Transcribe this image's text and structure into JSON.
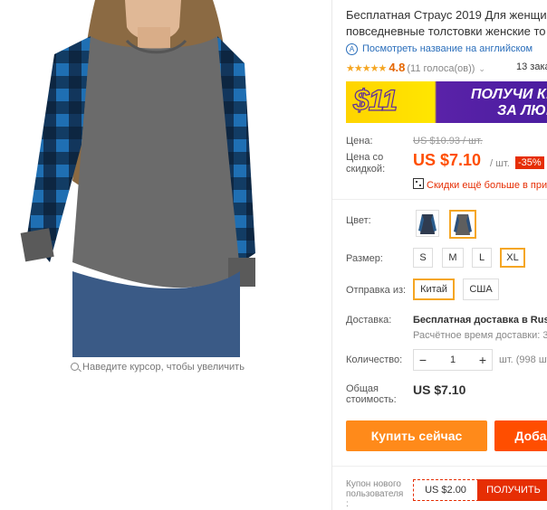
{
  "gallery": {
    "zoom_hint": "Наведите курсор, чтобы увеличить"
  },
  "product": {
    "title_line1": "Бесплатная Страус 2019 Для женщи",
    "title_line2": "повседневные толстовки женские то",
    "translate_link": "Посмотреть название на английском",
    "rating_value": "4.8",
    "votes": "(11 голоса(ов))",
    "orders": "13 зака"
  },
  "banner": {
    "amount": "$11",
    "line1": "ПОЛУЧИ КУ",
    "line2": "ЗА ЛЮБ"
  },
  "price": {
    "label": "Цена:",
    "old": "US $10.93 / шт.",
    "discount_label_1": "Цена со",
    "discount_label_2": "скидкой:",
    "new": "US $7.10",
    "unit": "/ шт.",
    "discount_badge": "-35%",
    "qr_text": "Скидки ещё больше в прил"
  },
  "options": {
    "color_label": "Цвет:",
    "size_label": "Размер:",
    "sizes": [
      "S",
      "M",
      "L",
      "XL"
    ],
    "selected_size": "XL",
    "ship_from_label": "Отправка из:",
    "ship_from": [
      "Китай",
      "США"
    ],
    "selected_ship_from": "Китай"
  },
  "delivery": {
    "label": "Доставка:",
    "value": "Бесплатная доставка в Russ",
    "time": "Расчётное время доставки: 30"
  },
  "quantity": {
    "label": "Количество:",
    "value": "1",
    "minus": "−",
    "plus": "+",
    "stock": "шт. (998 шт"
  },
  "total": {
    "label_1": "Общая",
    "label_2": "стоимость:",
    "value": "US $7.10"
  },
  "buttons": {
    "buy_now": "Купить сейчас",
    "add_to_cart": "Доба"
  },
  "coupon": {
    "label_1": "Купон нового",
    "label_2": "пользователя",
    "label_3": ":",
    "value": "US $2.00",
    "action": "ПОЛУЧИТЬ"
  },
  "colors": {
    "accent": "#ff4e00",
    "buy": "#ff8a1a",
    "selected_border": "#f5a623",
    "badge": "#e62e04",
    "link": "#2a6ebb"
  }
}
